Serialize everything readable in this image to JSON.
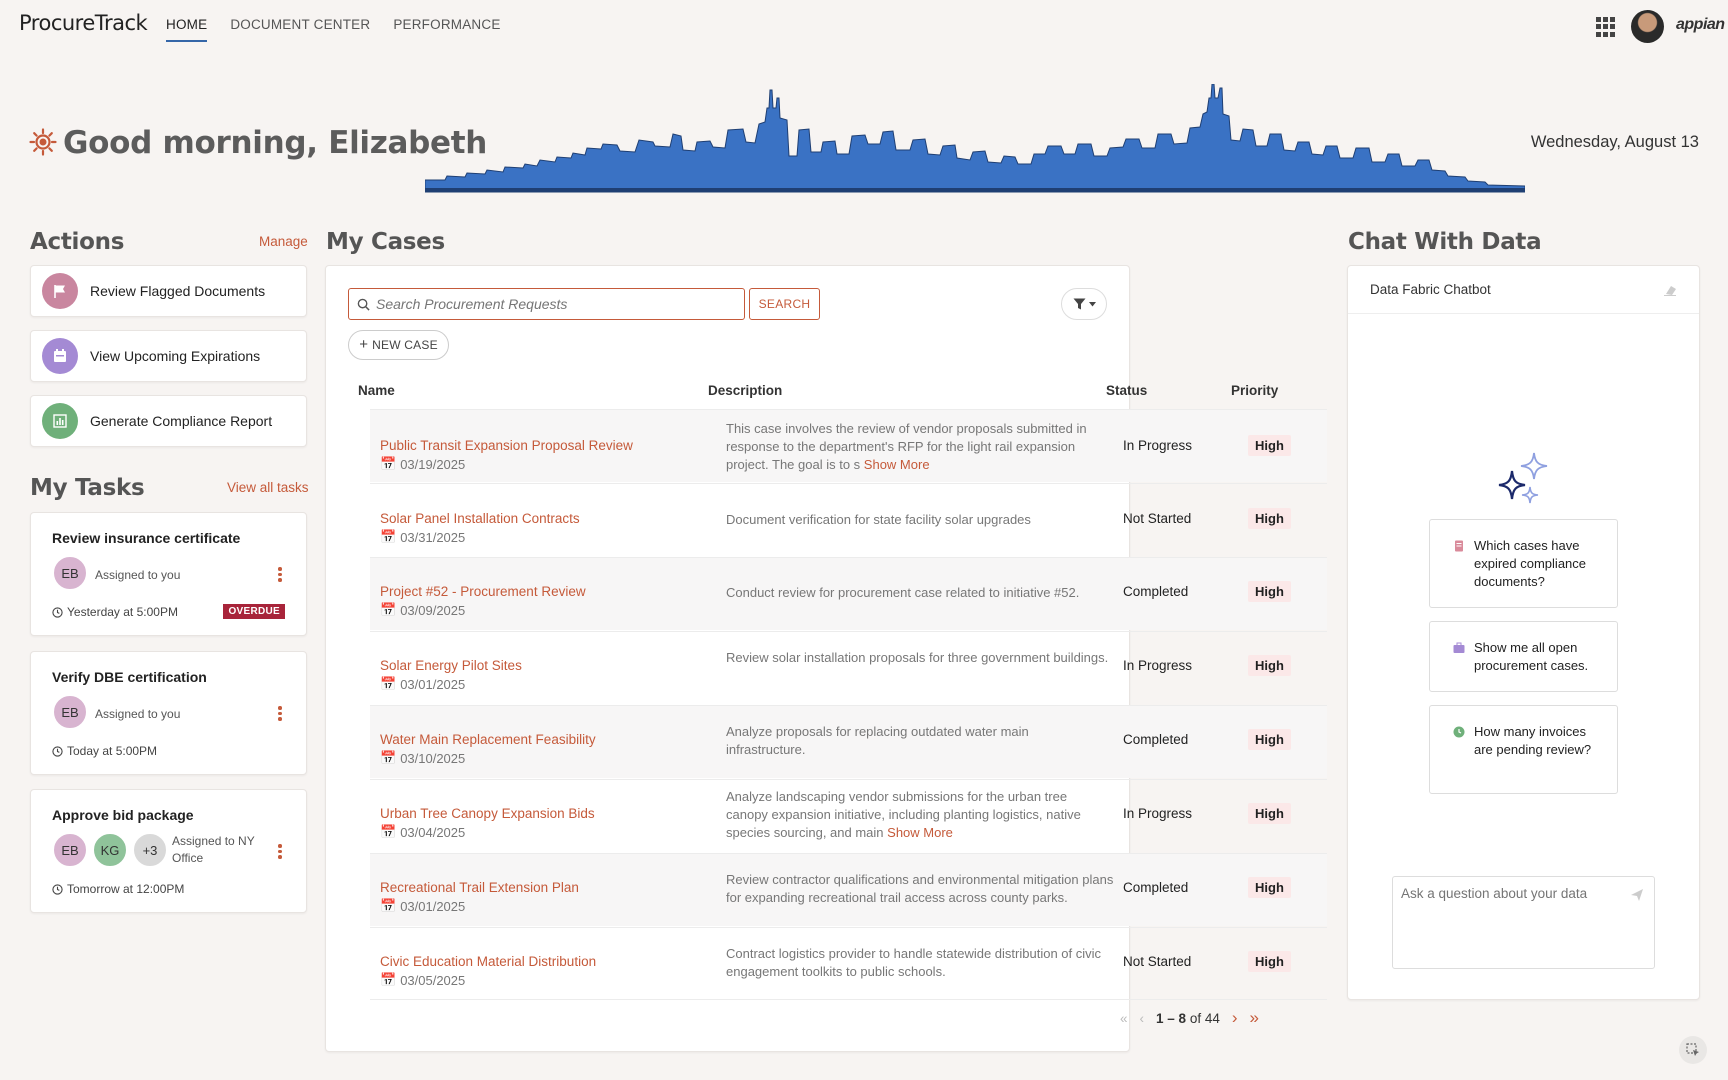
{
  "app": {
    "title": "ProcureTrack",
    "brand": "appian"
  },
  "nav": {
    "tabs": [
      "HOME",
      "DOCUMENT CENTER",
      "PERFORMANCE"
    ]
  },
  "greeting": {
    "text": "Good morning, Elizabeth",
    "date": "Wednesday, August 13"
  },
  "actions": {
    "title": "Actions",
    "manage_label": "Manage",
    "items": [
      {
        "label": "Review Flagged Documents",
        "icon": "flag-icon",
        "color": "#c9869f"
      },
      {
        "label": "View Upcoming Expirations",
        "icon": "calendar-icon",
        "color": "#a48ad4"
      },
      {
        "label": "Generate Compliance Report",
        "icon": "chart-icon",
        "color": "#6fb07a"
      }
    ]
  },
  "tasks": {
    "title": "My Tasks",
    "view_all_label": "View all tasks",
    "items": [
      {
        "title": "Review insurance certificate",
        "avatars": [
          "EB"
        ],
        "assigned": "Assigned to you",
        "due": "Yesterday at 5:00PM",
        "badge": "OVERDUE"
      },
      {
        "title": "Verify DBE certification",
        "avatars": [
          "EB"
        ],
        "assigned": "Assigned to you",
        "due": "Today at 5:00PM"
      },
      {
        "title": "Approve bid package",
        "avatars": [
          "EB",
          "KG",
          "+3"
        ],
        "assigned": "Assigned to NY Office",
        "due": "Tomorrow at 12:00PM"
      }
    ]
  },
  "cases": {
    "title": "My Cases",
    "search_placeholder": "Search Procurement Requests",
    "search_label": "SEARCH",
    "new_case_label": "NEW CASE",
    "columns": {
      "name": "Name",
      "description": "Description",
      "status": "Status",
      "priority": "Priority"
    },
    "show_more_label": "Show More",
    "rows": [
      {
        "name": "Public Transit Expansion Proposal Review",
        "date": "03/19/2025",
        "desc": "This case involves the review of vendor proposals submitted in response to the department's RFP for the light rail expansion project. The goal is to s",
        "more": true,
        "status": "In Progress",
        "priority": "High"
      },
      {
        "name": "Solar Panel Installation Contracts",
        "date": "03/31/2025",
        "desc": "Document verification for state facility solar upgrades",
        "status": "Not Started",
        "priority": "High"
      },
      {
        "name": "Project #52 - Procurement Review",
        "date": "03/09/2025",
        "desc": "Conduct review for procurement case related to initiative #52.",
        "status": "Completed",
        "priority": "High"
      },
      {
        "name": "Solar Energy Pilot Sites",
        "date": "03/01/2025",
        "desc": "Review solar installation proposals for three government buildings.",
        "status": "In Progress",
        "priority": "High"
      },
      {
        "name": "Water Main Replacement Feasibility",
        "date": "03/10/2025",
        "desc": "Analyze proposals for replacing outdated water main infrastructure.",
        "status": "Completed",
        "priority": "High"
      },
      {
        "name": "Urban Tree Canopy Expansion Bids",
        "date": "03/04/2025",
        "desc": "Analyze landscaping vendor submissions for the urban tree canopy expansion initiative, including planting logistics, native species sourcing, and main",
        "more": true,
        "status": "In Progress",
        "priority": "High"
      },
      {
        "name": "Recreational Trail Extension Plan",
        "date": "03/01/2025",
        "desc": "Review contractor qualifications and environmental mitigation plans for expanding recreational trail access across county parks.",
        "status": "Completed",
        "priority": "High"
      },
      {
        "name": "Civic Education Material Distribution",
        "date": "03/05/2025",
        "desc": "Contract logistics provider to handle statewide distribution of civic engagement toolkits to public schools.",
        "status": "Not Started",
        "priority": "High"
      }
    ],
    "pager": {
      "range": "1 – 8",
      "of": "of 44"
    }
  },
  "chat": {
    "title": "Chat With Data",
    "bot_name": "Data Fabric Chatbot",
    "suggestions": [
      {
        "text": "Which cases have expired compliance documents?",
        "icon": "document-icon",
        "color": "#d98a9a"
      },
      {
        "text": "Show me all open procurement cases.",
        "icon": "briefcase-icon",
        "color": "#a48ad4"
      },
      {
        "text": "How many invoices are pending review?",
        "icon": "clock-icon",
        "color": "#6fb07a"
      }
    ],
    "input_placeholder": "Ask a question about your data"
  },
  "colors": {
    "accent": "#c55a3a",
    "skyline": "#3a72c4",
    "overdue": "#a8243a"
  }
}
